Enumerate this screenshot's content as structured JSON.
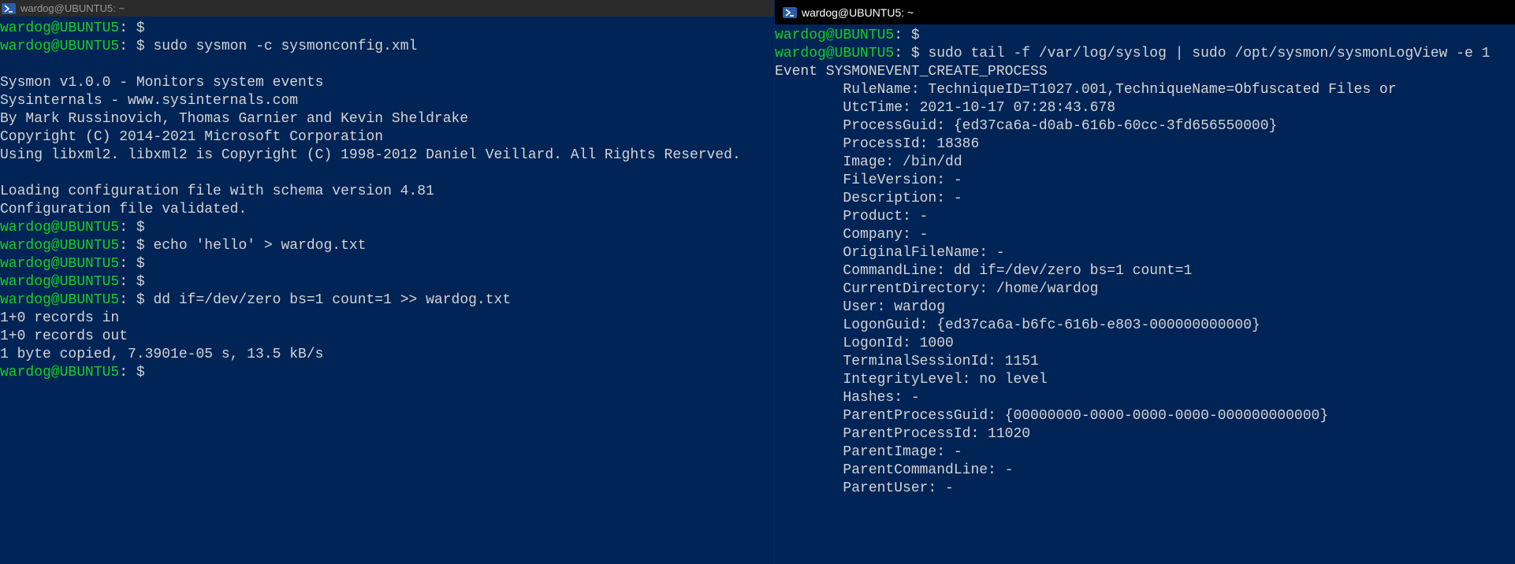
{
  "colors": {
    "background": "#012456",
    "prompt": "#13d024",
    "text": "#d4d4d4"
  },
  "left": {
    "title": "wardog@UBUNTU5: ~",
    "icon": "powershell-icon",
    "lines": [
      {
        "type": "prompt",
        "user": "wardog@UBUNTU5",
        "sep": ":",
        "cmd": " $ "
      },
      {
        "type": "prompt",
        "user": "wardog@UBUNTU5",
        "sep": ":",
        "cmd": " $ sudo sysmon -c sysmonconfig.xml"
      },
      {
        "type": "text",
        "text": ""
      },
      {
        "type": "text",
        "text": "Sysmon v1.0.0 - Monitors system events"
      },
      {
        "type": "text",
        "text": "Sysinternals - www.sysinternals.com"
      },
      {
        "type": "text",
        "text": "By Mark Russinovich, Thomas Garnier and Kevin Sheldrake"
      },
      {
        "type": "text",
        "text": "Copyright (C) 2014-2021 Microsoft Corporation"
      },
      {
        "type": "text",
        "text": "Using libxml2. libxml2 is Copyright (C) 1998-2012 Daniel Veillard. All Rights Reserved."
      },
      {
        "type": "text",
        "text": ""
      },
      {
        "type": "text",
        "text": "Loading configuration file with schema version 4.81"
      },
      {
        "type": "text",
        "text": "Configuration file validated."
      },
      {
        "type": "prompt",
        "user": "wardog@UBUNTU5",
        "sep": ":",
        "cmd": " $ "
      },
      {
        "type": "prompt",
        "user": "wardog@UBUNTU5",
        "sep": ":",
        "cmd": " $ echo 'hello' > wardog.txt"
      },
      {
        "type": "prompt",
        "user": "wardog@UBUNTU5",
        "sep": ":",
        "cmd": " $ "
      },
      {
        "type": "prompt",
        "user": "wardog@UBUNTU5",
        "sep": ":",
        "cmd": " $ "
      },
      {
        "type": "prompt",
        "user": "wardog@UBUNTU5",
        "sep": ":",
        "cmd": " $ dd if=/dev/zero bs=1 count=1 >> wardog.txt"
      },
      {
        "type": "text",
        "text": "1+0 records in"
      },
      {
        "type": "text",
        "text": "1+0 records out"
      },
      {
        "type": "text",
        "text": "1 byte copied, 7.3901e-05 s, 13.5 kB/s"
      },
      {
        "type": "prompt",
        "user": "wardog@UBUNTU5",
        "sep": ":",
        "cmd": " $ ",
        "cursor": false
      }
    ]
  },
  "right": {
    "title": "wardog@UBUNTU5: ~",
    "icon": "powershell-icon",
    "lines": [
      {
        "type": "prompt",
        "user": "wardog@UBUNTU5",
        "sep": ":",
        "cmd": " $ "
      },
      {
        "type": "prompt",
        "user": "wardog@UBUNTU5",
        "sep": ":",
        "cmd": " $ sudo tail -f /var/log/syslog | sudo /opt/sysmon/sysmonLogView -e 1"
      },
      {
        "type": "text",
        "text": "Event SYSMONEVENT_CREATE_PROCESS"
      },
      {
        "type": "text",
        "text": "        RuleName: TechniqueID=T1027.001,TechniqueName=Obfuscated Files or"
      },
      {
        "type": "text",
        "text": "        UtcTime: 2021-10-17 07:28:43.678"
      },
      {
        "type": "text",
        "text": "        ProcessGuid: {ed37ca6a-d0ab-616b-60cc-3fd656550000}"
      },
      {
        "type": "text",
        "text": "        ProcessId: 18386"
      },
      {
        "type": "text",
        "text": "        Image: /bin/dd"
      },
      {
        "type": "text",
        "text": "        FileVersion: -"
      },
      {
        "type": "text",
        "text": "        Description: -"
      },
      {
        "type": "text",
        "text": "        Product: -"
      },
      {
        "type": "text",
        "text": "        Company: -"
      },
      {
        "type": "text",
        "text": "        OriginalFileName: -"
      },
      {
        "type": "text",
        "text": "        CommandLine: dd if=/dev/zero bs=1 count=1"
      },
      {
        "type": "text",
        "text": "        CurrentDirectory: /home/wardog"
      },
      {
        "type": "text",
        "text": "        User: wardog"
      },
      {
        "type": "text",
        "text": "        LogonGuid: {ed37ca6a-b6fc-616b-e803-000000000000}"
      },
      {
        "type": "text",
        "text": "        LogonId: 1000"
      },
      {
        "type": "text",
        "text": "        TerminalSessionId: 1151"
      },
      {
        "type": "text",
        "text": "        IntegrityLevel: no level"
      },
      {
        "type": "text",
        "text": "        Hashes: -"
      },
      {
        "type": "text",
        "text": "        ParentProcessGuid: {00000000-0000-0000-0000-000000000000}"
      },
      {
        "type": "text",
        "text": "        ParentProcessId: 11020"
      },
      {
        "type": "text",
        "text": "        ParentImage: -"
      },
      {
        "type": "text",
        "text": "        ParentCommandLine: -"
      },
      {
        "type": "text",
        "text": "        ParentUser: -"
      }
    ]
  }
}
